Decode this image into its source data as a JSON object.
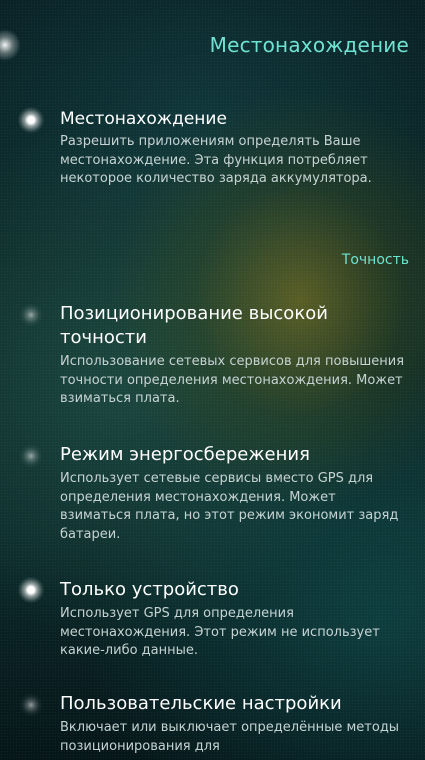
{
  "header": {
    "title": "Местонахождение"
  },
  "location_toggle": {
    "title": "Местонахождение",
    "description": "Разрешить приложениям определять Ваше местонахождение. Эта функция потребляет некоторое количество заряда аккумулятора.",
    "enabled": true
  },
  "accuracy_section": {
    "header": "Точность",
    "options": [
      {
        "title": "Позиционирование высокой точности",
        "description": "Использование сетевых сервисов для повышения точности определения местонахождения. Может взиматься плата.",
        "selected": false
      },
      {
        "title": "Режим энергосбережения",
        "description": "Использует сетевые сервисы вместо GPS для определения местонахождения. Может взиматься плата, но этот режим экономит заряд батареи.",
        "selected": false
      },
      {
        "title": "Только устройство",
        "description": "Использует GPS для определения местонахождения. Этот режим не использует какие-либо данные.",
        "selected": true
      },
      {
        "title": "Пользовательские настройки",
        "description": "Включает или выключает определённые методы позиционирования для",
        "selected": false
      }
    ]
  },
  "colors": {
    "accent": "#6fe3d2",
    "text_primary": "#ffffff",
    "text_secondary": "#c6d3d3",
    "background": "#0c2a2b"
  }
}
